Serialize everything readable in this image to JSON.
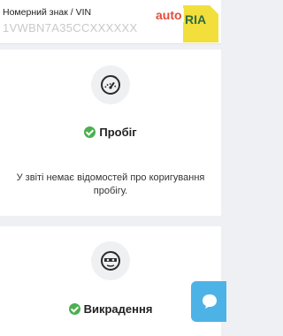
{
  "header": {
    "vin_label": "Номерний знак / VIN",
    "vin_placeholder": "1VWBN7A35CCXXXXXX",
    "logo_auto": "auto",
    "logo_ria": "RIA"
  },
  "mileage": {
    "icon": "speedometer-icon",
    "status": "Пробіг",
    "status_icon": "check-circle-icon",
    "note": "У звіті немає відомостей про коригування пробігу."
  },
  "theft": {
    "icon": "thief-mask-icon",
    "status": "Викрадення",
    "status_icon": "check-circle-icon"
  },
  "chat": {
    "icon": "chat-bubble-icon"
  },
  "colors": {
    "background": "#eef0f3",
    "success": "#4caf50",
    "chat_button": "#4db3e6",
    "logo_yellow": "#f2df3c",
    "logo_red": "#e64b3c"
  }
}
